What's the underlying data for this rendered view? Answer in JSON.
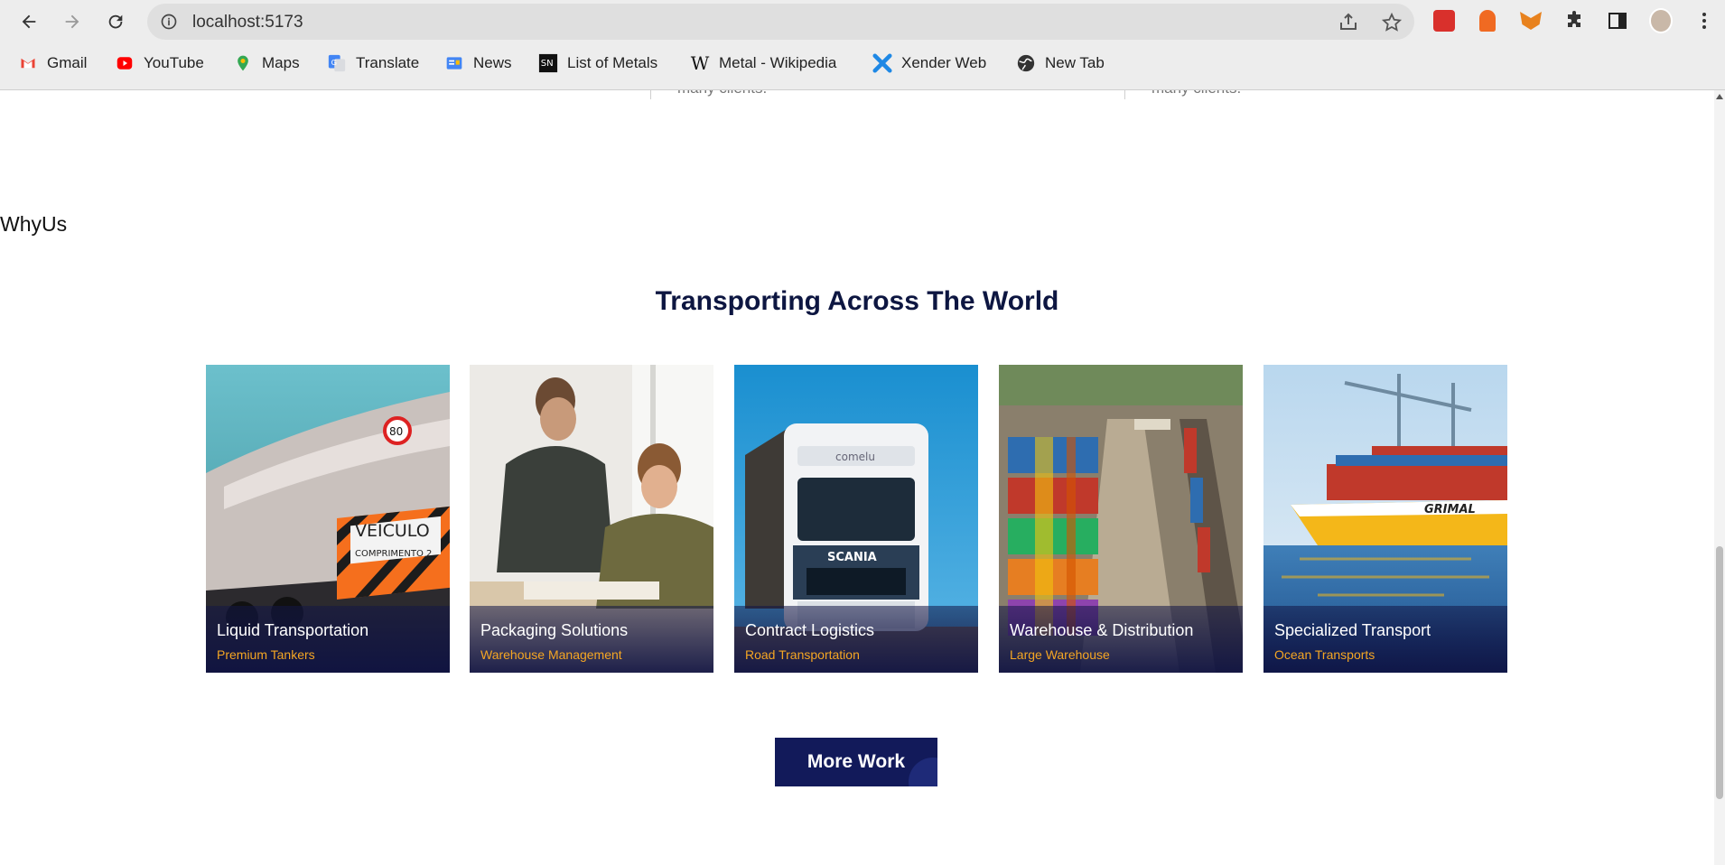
{
  "browser": {
    "url": "localhost:5173",
    "bookmarks": [
      {
        "label": "Gmail",
        "icon": "gmail-icon"
      },
      {
        "label": "YouTube",
        "icon": "youtube-icon"
      },
      {
        "label": "Maps",
        "icon": "maps-icon"
      },
      {
        "label": "Translate",
        "icon": "translate-icon"
      },
      {
        "label": "News",
        "icon": "news-icon"
      },
      {
        "label": "List of Metals",
        "icon": "sn-icon"
      },
      {
        "label": "Metal - Wikipedia",
        "icon": "wikipedia-icon"
      },
      {
        "label": "Xender Web",
        "icon": "xender-icon"
      },
      {
        "label": "New Tab",
        "icon": "globe-icon"
      }
    ]
  },
  "page": {
    "previous_section_text_1": "many clients.",
    "previous_section_text_2": "many clients.",
    "whyus_label": "WhyUs",
    "section_title": "Transporting Across The World",
    "cards": [
      {
        "title": "Liquid Transportation",
        "subtitle": "Premium Tankers"
      },
      {
        "title": "Packaging Solutions",
        "subtitle": "Warehouse Management"
      },
      {
        "title": "Contract Logistics",
        "subtitle": "Road Transportation"
      },
      {
        "title": "Warehouse & Distribution",
        "subtitle": "Large Warehouse"
      },
      {
        "title": "Specialized Transport",
        "subtitle": "Ocean Transports"
      }
    ],
    "more_button": "More Work"
  },
  "colors": {
    "heading": "#0d1641",
    "accent": "#f5a623",
    "button": "#121a5a"
  }
}
